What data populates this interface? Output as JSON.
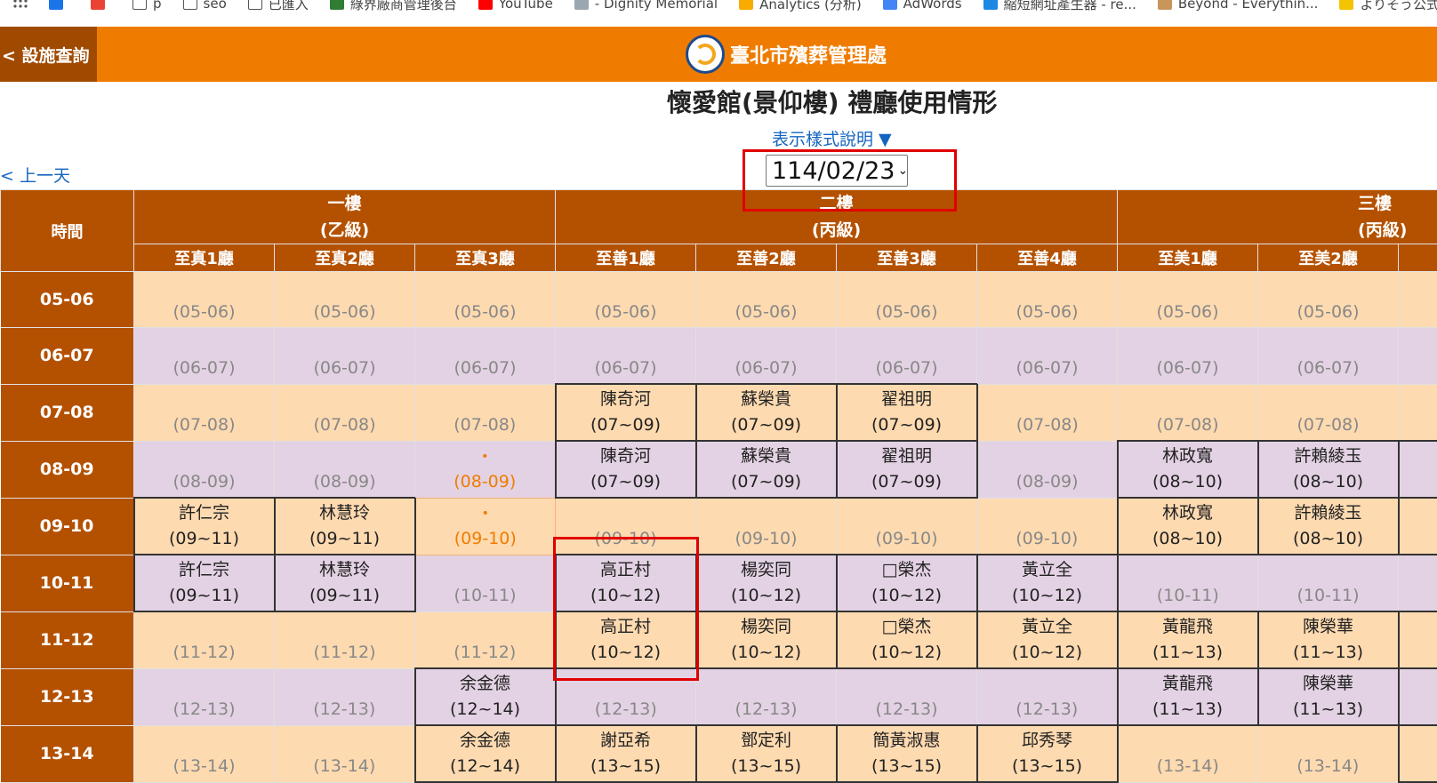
{
  "bookmarks": [
    {
      "label": "",
      "icon": "apps-grid-icon"
    },
    {
      "label": "",
      "icon": "calendar-16-icon"
    },
    {
      "label": "",
      "icon": "gmail-icon"
    },
    {
      "label": "p",
      "icon": "folder-icon"
    },
    {
      "label": "seo",
      "icon": "folder-icon"
    },
    {
      "label": "已匯入",
      "icon": "folder-icon"
    },
    {
      "label": "綠界廠商管理後台",
      "icon": "ecpay-icon"
    },
    {
      "label": "YouTube",
      "icon": "youtube-icon"
    },
    {
      "label": "- Dignity Memorial",
      "icon": "dignity-icon"
    },
    {
      "label": "Analytics (分析)",
      "icon": "analytics-icon"
    },
    {
      "label": "AdWords",
      "icon": "google-icon"
    },
    {
      "label": "縮短網址產生器 - re...",
      "icon": "link-icon"
    },
    {
      "label": "Beyond - Everythin...",
      "icon": "avatar-icon"
    },
    {
      "label": "よりそう公式",
      "icon": "yorisou-icon"
    }
  ],
  "header": {
    "back_label": "< 設施查詢",
    "org_name": "臺北市殯葬管理處"
  },
  "page": {
    "title": "懷愛館(景仰樓) 禮廳使用情形",
    "legend_toggle": "表示樣式說明 ▼",
    "prev_day": "< 上一天",
    "date_value": "114/02/23"
  },
  "colors": {
    "header_orange": "#ef7c00",
    "table_header_brown": "#b45100",
    "row_peach": "#fedab0",
    "row_lavender": "#e3d2e3",
    "link_blue": "#1565c0",
    "highlight_red": "#e00000"
  },
  "table": {
    "time_header": "時間",
    "floors": [
      {
        "name": "一樓",
        "grade": "(乙級)"
      },
      {
        "name": "二樓",
        "grade": "(丙級)"
      },
      {
        "name": "三樓",
        "grade": "(丙級)"
      }
    ],
    "halls": [
      "至真1廳",
      "至真2廳",
      "至真3廳",
      "至善1廳",
      "至善2廳",
      "至善3廳",
      "至善4廳",
      "至美1廳",
      "至美2廳",
      ""
    ],
    "rows": [
      {
        "time": "05-06",
        "cells": [
          {
            "name": "",
            "range": "(05-06)",
            "state": "free"
          },
          {
            "name": "",
            "range": "(05-06)",
            "state": "free"
          },
          {
            "name": "",
            "range": "(05-06)",
            "state": "free"
          },
          {
            "name": "",
            "range": "(05-06)",
            "state": "free"
          },
          {
            "name": "",
            "range": "(05-06)",
            "state": "free"
          },
          {
            "name": "",
            "range": "(05-06)",
            "state": "free"
          },
          {
            "name": "",
            "range": "(05-06)",
            "state": "free"
          },
          {
            "name": "",
            "range": "(05-06)",
            "state": "free"
          },
          {
            "name": "",
            "range": "(05-06)",
            "state": "free"
          },
          {
            "name": "",
            "range": "",
            "state": "free"
          }
        ]
      },
      {
        "time": "06-07",
        "cells": [
          {
            "name": "",
            "range": "(06-07)",
            "state": "free"
          },
          {
            "name": "",
            "range": "(06-07)",
            "state": "free"
          },
          {
            "name": "",
            "range": "(06-07)",
            "state": "free"
          },
          {
            "name": "",
            "range": "(06-07)",
            "state": "free"
          },
          {
            "name": "",
            "range": "(06-07)",
            "state": "free"
          },
          {
            "name": "",
            "range": "(06-07)",
            "state": "free"
          },
          {
            "name": "",
            "range": "(06-07)",
            "state": "free"
          },
          {
            "name": "",
            "range": "(06-07)",
            "state": "free"
          },
          {
            "name": "",
            "range": "(06-07)",
            "state": "free"
          },
          {
            "name": "",
            "range": "",
            "state": "free"
          }
        ]
      },
      {
        "time": "07-08",
        "cells": [
          {
            "name": "",
            "range": "(07-08)",
            "state": "free"
          },
          {
            "name": "",
            "range": "(07-08)",
            "state": "free"
          },
          {
            "name": "",
            "range": "(07-08)",
            "state": "free"
          },
          {
            "name": "陳奇河",
            "range": "(07~09)",
            "state": "booked"
          },
          {
            "name": "蘇榮貴",
            "range": "(07~09)",
            "state": "booked"
          },
          {
            "name": "翟祖明",
            "range": "(07~09)",
            "state": "booked"
          },
          {
            "name": "",
            "range": "(07-08)",
            "state": "free"
          },
          {
            "name": "",
            "range": "(07-08)",
            "state": "free"
          },
          {
            "name": "",
            "range": "(07-08)",
            "state": "free"
          },
          {
            "name": "",
            "range": "",
            "state": "free"
          }
        ]
      },
      {
        "time": "08-09",
        "cells": [
          {
            "name": "",
            "range": "(08-09)",
            "state": "free"
          },
          {
            "name": "",
            "range": "(08-09)",
            "state": "free"
          },
          {
            "name": "•",
            "range": "(08-09)",
            "state": "pending"
          },
          {
            "name": "陳奇河",
            "range": "(07~09)",
            "state": "booked"
          },
          {
            "name": "蘇榮貴",
            "range": "(07~09)",
            "state": "booked"
          },
          {
            "name": "翟祖明",
            "range": "(07~09)",
            "state": "booked"
          },
          {
            "name": "",
            "range": "(08-09)",
            "state": "free"
          },
          {
            "name": "林政寬",
            "range": "(08~10)",
            "state": "booked"
          },
          {
            "name": "許賴綾玉",
            "range": "(08~10)",
            "state": "booked"
          },
          {
            "name": "",
            "range": "",
            "state": "booked"
          }
        ]
      },
      {
        "time": "09-10",
        "cells": [
          {
            "name": "許仁宗",
            "range": "(09~11)",
            "state": "booked"
          },
          {
            "name": "林慧玲",
            "range": "(09~11)",
            "state": "booked"
          },
          {
            "name": "•",
            "range": "(09-10)",
            "state": "pending"
          },
          {
            "name": "",
            "range": "(09-10)",
            "state": "free"
          },
          {
            "name": "",
            "range": "(09-10)",
            "state": "free"
          },
          {
            "name": "",
            "range": "(09-10)",
            "state": "free"
          },
          {
            "name": "",
            "range": "(09-10)",
            "state": "free"
          },
          {
            "name": "林政寬",
            "range": "(08~10)",
            "state": "booked"
          },
          {
            "name": "許賴綾玉",
            "range": "(08~10)",
            "state": "booked"
          },
          {
            "name": "",
            "range": "",
            "state": "booked"
          }
        ]
      },
      {
        "time": "10-11",
        "cells": [
          {
            "name": "許仁宗",
            "range": "(09~11)",
            "state": "booked"
          },
          {
            "name": "林慧玲",
            "range": "(09~11)",
            "state": "booked"
          },
          {
            "name": "",
            "range": "(10-11)",
            "state": "free"
          },
          {
            "name": "高正村",
            "range": "(10~12)",
            "state": "booked"
          },
          {
            "name": "楊奕同",
            "range": "(10~12)",
            "state": "booked"
          },
          {
            "name": "□榮杰",
            "range": "(10~12)",
            "state": "booked"
          },
          {
            "name": "黃立全",
            "range": "(10~12)",
            "state": "booked"
          },
          {
            "name": "",
            "range": "(10-11)",
            "state": "free"
          },
          {
            "name": "",
            "range": "(10-11)",
            "state": "free"
          },
          {
            "name": "",
            "range": "",
            "state": "free"
          }
        ]
      },
      {
        "time": "11-12",
        "cells": [
          {
            "name": "",
            "range": "(11-12)",
            "state": "free"
          },
          {
            "name": "",
            "range": "(11-12)",
            "state": "free"
          },
          {
            "name": "",
            "range": "(11-12)",
            "state": "free"
          },
          {
            "name": "高正村",
            "range": "(10~12)",
            "state": "booked"
          },
          {
            "name": "楊奕同",
            "range": "(10~12)",
            "state": "booked"
          },
          {
            "name": "□榮杰",
            "range": "(10~12)",
            "state": "booked"
          },
          {
            "name": "黃立全",
            "range": "(10~12)",
            "state": "booked"
          },
          {
            "name": "黃龍飛",
            "range": "(11~13)",
            "state": "booked"
          },
          {
            "name": "陳榮華",
            "range": "(11~13)",
            "state": "booked"
          },
          {
            "name": "",
            "range": "",
            "state": "booked"
          }
        ]
      },
      {
        "time": "12-13",
        "cells": [
          {
            "name": "",
            "range": "(12-13)",
            "state": "free"
          },
          {
            "name": "",
            "range": "(12-13)",
            "state": "free"
          },
          {
            "name": "余金德",
            "range": "(12~14)",
            "state": "booked"
          },
          {
            "name": "",
            "range": "(12-13)",
            "state": "free"
          },
          {
            "name": "",
            "range": "(12-13)",
            "state": "free"
          },
          {
            "name": "",
            "range": "(12-13)",
            "state": "free"
          },
          {
            "name": "",
            "range": "(12-13)",
            "state": "free"
          },
          {
            "name": "黃龍飛",
            "range": "(11~13)",
            "state": "booked"
          },
          {
            "name": "陳榮華",
            "range": "(11~13)",
            "state": "booked"
          },
          {
            "name": "",
            "range": "",
            "state": "booked"
          }
        ]
      },
      {
        "time": "13-14",
        "cells": [
          {
            "name": "",
            "range": "(13-14)",
            "state": "free"
          },
          {
            "name": "",
            "range": "(13-14)",
            "state": "free"
          },
          {
            "name": "余金德",
            "range": "(12~14)",
            "state": "booked"
          },
          {
            "name": "謝亞希",
            "range": "(13~15)",
            "state": "booked"
          },
          {
            "name": "鄧定利",
            "range": "(13~15)",
            "state": "booked"
          },
          {
            "name": "簡黃淑惠",
            "range": "(13~15)",
            "state": "booked"
          },
          {
            "name": "邱秀琴",
            "range": "(13~15)",
            "state": "booked"
          },
          {
            "name": "",
            "range": "(13-14)",
            "state": "free"
          },
          {
            "name": "",
            "range": "(13-14)",
            "state": "free"
          },
          {
            "name": "",
            "range": "",
            "state": "booked"
          }
        ]
      }
    ]
  }
}
